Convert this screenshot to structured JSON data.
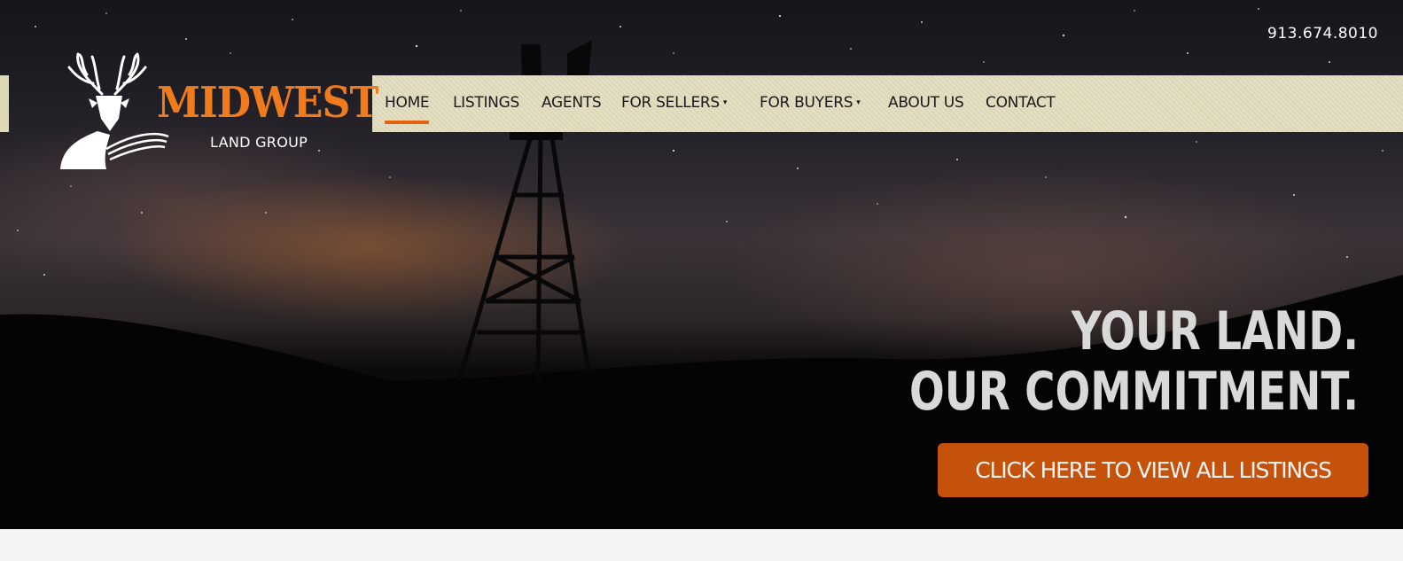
{
  "header": {
    "phone": "913.674.8010"
  },
  "logo": {
    "wordmark": "MIDWEST",
    "subtitle": "LAND GROUP",
    "icon": "deer-icon"
  },
  "nav": {
    "items": [
      {
        "label": "HOME",
        "active": true,
        "has_dropdown": false
      },
      {
        "label": "LISTINGS",
        "active": false,
        "has_dropdown": false
      },
      {
        "label": "AGENTS",
        "active": false,
        "has_dropdown": false
      },
      {
        "label": "FOR SELLERS",
        "active": false,
        "has_dropdown": true
      },
      {
        "label": "FOR BUYERS",
        "active": false,
        "has_dropdown": true
      },
      {
        "label": "ABOUT US",
        "active": false,
        "has_dropdown": false
      },
      {
        "label": "CONTACT",
        "active": false,
        "has_dropdown": false
      }
    ],
    "caret": "▾"
  },
  "hero": {
    "tagline_line1": "YOUR LAND.",
    "tagline_line2": "OUR COMMITMENT.",
    "cta_label": "CLICK HERE TO VIEW ALL LISTINGS"
  },
  "colors": {
    "accent": "#e2620e",
    "cta": "#c4520b",
    "nav_bg": "#e3ddbf",
    "logo_orange": "#f07b1d"
  }
}
